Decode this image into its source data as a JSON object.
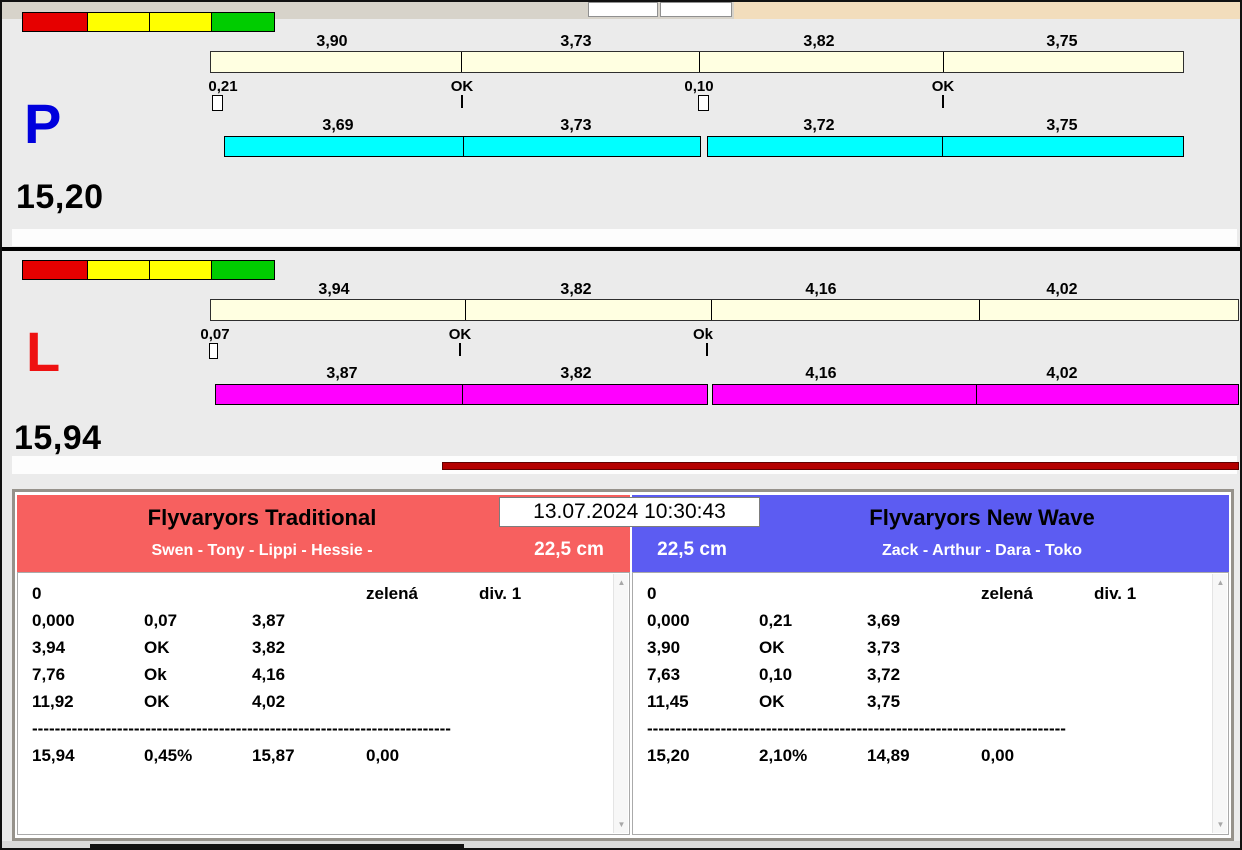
{
  "window": {
    "datetime": "13.07.2024 10:30:43"
  },
  "lanes": [
    {
      "letter": "P",
      "letter_color": "#0000dd",
      "total": "15,20",
      "top_splits": [
        "3,90",
        "3,73",
        "3,82",
        "3,75"
      ],
      "checkpoints": [
        "0,21",
        "OK",
        "0,10",
        "OK"
      ],
      "bottom_splits": [
        "3,69",
        "3,73",
        "3,72",
        "3,75"
      ],
      "bar_color": "#00ffff"
    },
    {
      "letter": "L",
      "letter_color": "#ee1111",
      "total": "15,94",
      "top_splits": [
        "3,94",
        "3,82",
        "4,16",
        "4,02"
      ],
      "checkpoints": [
        "0,07",
        "OK",
        "Ok"
      ],
      "bottom_splits": [
        "3,87",
        "3,82",
        "4,16",
        "4,02"
      ],
      "bar_color": "#ff00ff"
    }
  ],
  "teams": [
    {
      "name": "Flyvaryors Traditional",
      "members": "Swen - Tony - Lippi - Hessie -",
      "size_label": "22,5 cm",
      "header_color": "#f7605f",
      "head_row": {
        "c0": "0",
        "c3": "zelená",
        "c4": "div. 1"
      },
      "rows": [
        [
          "0,000",
          "0,07",
          "3,87"
        ],
        [
          "3,94",
          "OK",
          "3,82"
        ],
        [
          "7,76",
          "Ok",
          "4,16"
        ],
        [
          "11,92",
          "OK",
          "4,02"
        ]
      ],
      "separator": "--------------------------------------------------------------------------",
      "summary": [
        "15,94",
        "0,45%",
        "15,87",
        "0,00"
      ]
    },
    {
      "name": "Flyvaryors New Wave",
      "members": "Zack - Arthur - Dara - Toko",
      "size_label": "22,5 cm",
      "header_color": "#5c5cf2",
      "head_row": {
        "c0": "0",
        "c3": "zelená",
        "c4": "div. 1"
      },
      "rows": [
        [
          "0,000",
          "0,21",
          "3,69"
        ],
        [
          "3,90",
          "OK",
          "3,73"
        ],
        [
          "7,63",
          "0,10",
          "3,72"
        ],
        [
          "11,45",
          "OK",
          "3,75"
        ]
      ],
      "separator": "--------------------------------------------------------------------------",
      "summary": [
        "15,20",
        "2,10%",
        "14,89",
        "0,00"
      ]
    }
  ],
  "colors": {
    "cream_bar": "#ffffe1",
    "progress_bar": "#b40000",
    "indicator_segments": [
      "#e60000",
      "#ffff00",
      "#ffff00",
      "#00cc00"
    ]
  }
}
